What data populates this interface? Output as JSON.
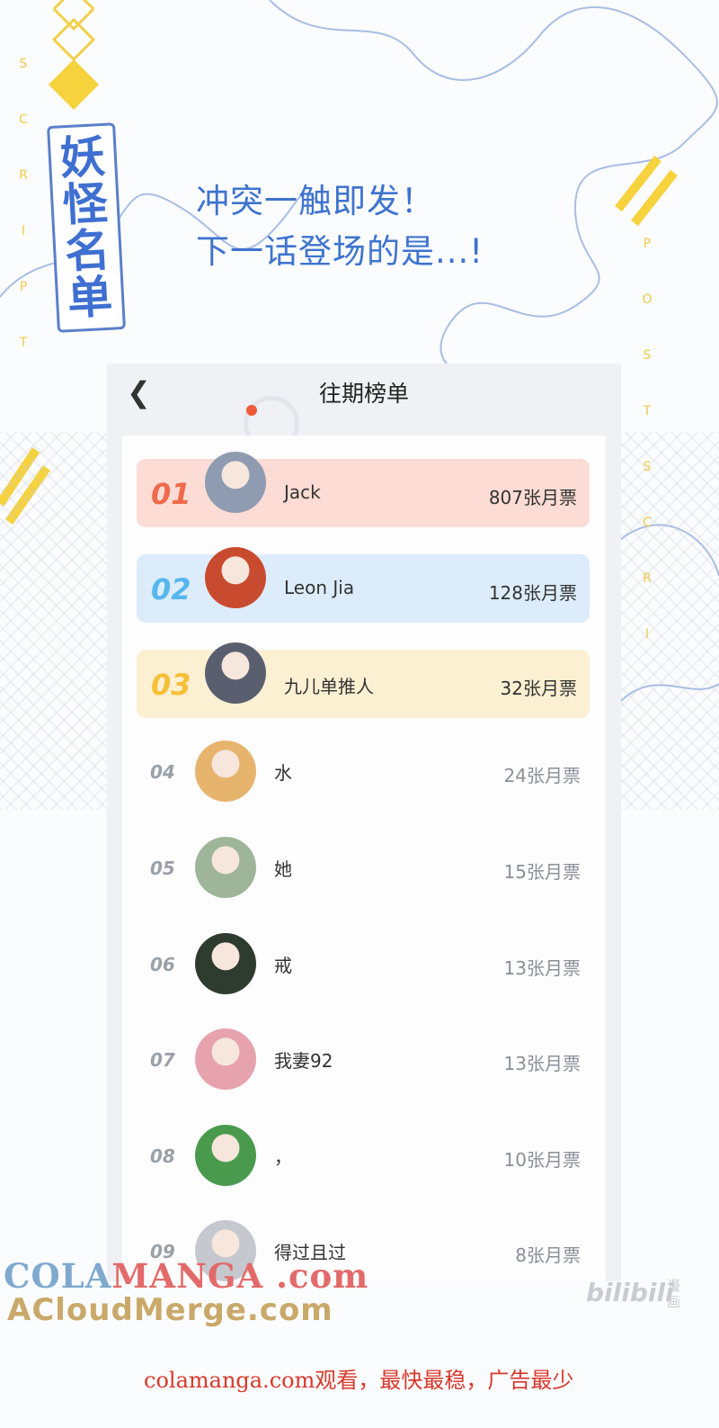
{
  "logo": {
    "lines": [
      "妖",
      "怪",
      "名",
      "单"
    ]
  },
  "side_left": {
    "letters": [
      "S",
      "C",
      "R",
      "I",
      "P",
      "T"
    ]
  },
  "side_right": {
    "letters": [
      "P",
      "O",
      "S",
      "T",
      "S",
      "C",
      "R",
      "I"
    ]
  },
  "headline": {
    "line1": "冲突一触即发！",
    "line2": "下一话登场的是...!"
  },
  "screen": {
    "title": "往期榜单",
    "back_icon": "chevron-left-icon",
    "ranking": [
      {
        "rank": "01",
        "name": "Jack",
        "votes": "807张月票",
        "bg": "#fcdcd4",
        "rank_color": "#ef6a4a",
        "avatar_color": "#8e9bb0"
      },
      {
        "rank": "02",
        "name": "Leon Jia",
        "votes": "128张月票",
        "bg": "#dcecfb",
        "rank_color": "#57b6ee",
        "avatar_color": "#c94b2f"
      },
      {
        "rank": "03",
        "name": "九儿单推人",
        "votes": "32张月票",
        "bg": "#fcf0d2",
        "rank_color": "#f5c038",
        "avatar_color": "#5a5f70"
      },
      {
        "rank": "04",
        "name": "水",
        "votes": "24张月票",
        "avatar_color": "#e7b46e"
      },
      {
        "rank": "05",
        "name": "她",
        "votes": "15张月票",
        "avatar_color": "#9fb59a"
      },
      {
        "rank": "06",
        "name": "戒",
        "votes": "13张月票",
        "avatar_color": "#2e3b2f"
      },
      {
        "rank": "07",
        "name": "我妻92",
        "votes": "13张月票",
        "avatar_color": "#e6a3ad"
      },
      {
        "rank": "08",
        "name": "，",
        "votes": "10张月票",
        "avatar_color": "#4a9a4e"
      },
      {
        "rank": "09",
        "name": "得过且过",
        "votes": "8张月票",
        "avatar_color": "#c6c8cf"
      }
    ]
  },
  "watermark": {
    "line1_a": "COLA",
    "line1_b": "MANGA",
    "line1_c": " .com",
    "line2": "ACloudMerge.com",
    "bili": "bilibili",
    "bili_sub": "漫画"
  },
  "footer": "colamanga.com观看，最快最稳，广告最少"
}
